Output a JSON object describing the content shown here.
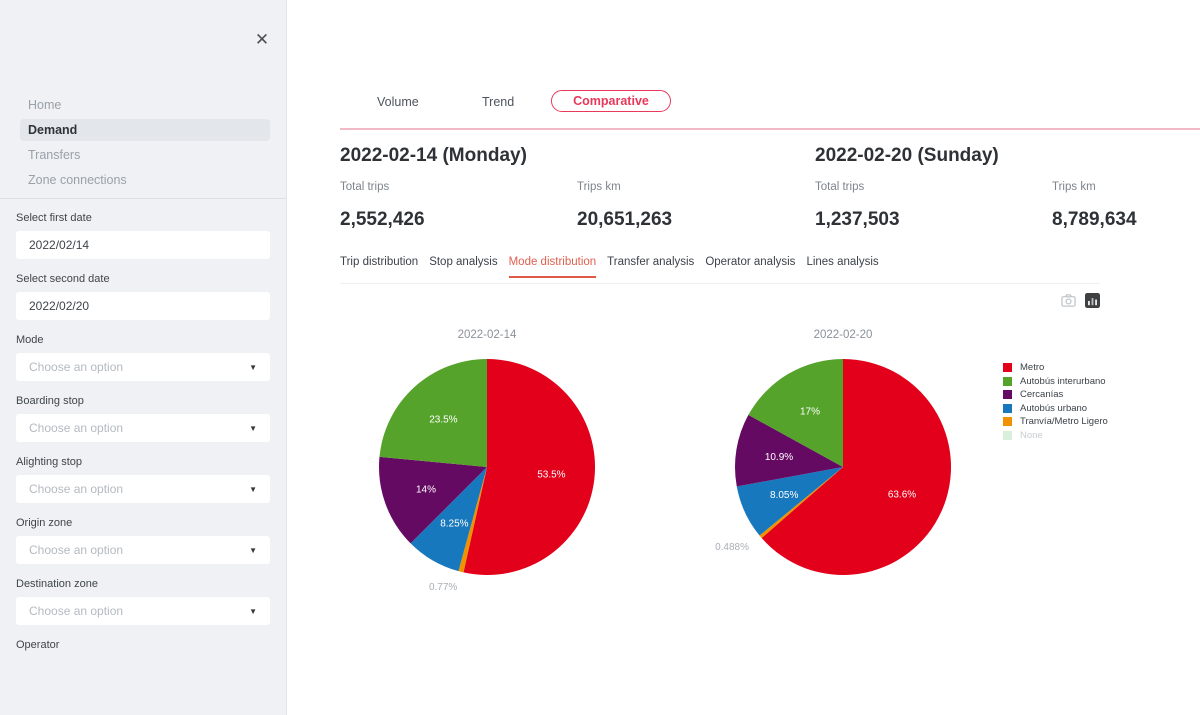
{
  "sidebar": {
    "close_icon": "✕",
    "nav": [
      {
        "label": "Home",
        "active": false
      },
      {
        "label": "Demand",
        "active": true
      },
      {
        "label": "Transfers",
        "active": false
      },
      {
        "label": "Zone connections",
        "active": false
      }
    ],
    "fields": [
      {
        "label": "Select first date",
        "type": "input",
        "value": "2022/02/14"
      },
      {
        "label": "Select second date",
        "type": "input",
        "value": "2022/02/20"
      },
      {
        "label": "Mode",
        "type": "select",
        "placeholder": "Choose an option"
      },
      {
        "label": "Boarding stop",
        "type": "select",
        "placeholder": "Choose an option"
      },
      {
        "label": "Alighting stop",
        "type": "select",
        "placeholder": "Choose an option"
      },
      {
        "label": "Origin zone",
        "type": "select",
        "placeholder": "Choose an option"
      },
      {
        "label": "Destination zone",
        "type": "select",
        "placeholder": "Choose an option"
      },
      {
        "label": "Operator",
        "type": "label-only"
      }
    ]
  },
  "main": {
    "tabs": [
      {
        "label": "Volume",
        "active": false
      },
      {
        "label": "Trend",
        "active": false
      },
      {
        "label": "Comparative",
        "active": true
      }
    ],
    "panels": [
      {
        "title": "2022-02-14 (Monday)",
        "stats": [
          {
            "label": "Total trips",
            "value": "2,552,426"
          },
          {
            "label": "Trips km",
            "value": "20,651,263"
          }
        ]
      },
      {
        "title": "2022-02-20 (Sunday)",
        "stats": [
          {
            "label": "Total trips",
            "value": "1,237,503"
          },
          {
            "label": "Trips km",
            "value": "8,789,634"
          }
        ]
      }
    ],
    "subtabs": [
      {
        "label": "Trip distribution",
        "active": false
      },
      {
        "label": "Stop analysis",
        "active": false
      },
      {
        "label": "Mode distribution",
        "active": true
      },
      {
        "label": "Transfer analysis",
        "active": false
      },
      {
        "label": "Operator analysis",
        "active": false
      },
      {
        "label": "Lines analysis",
        "active": false
      }
    ]
  },
  "chart_data": [
    {
      "type": "pie",
      "title": "2022-02-14",
      "direction": "clockwise",
      "start_angle": "top",
      "labels": [
        "Metro",
        "Tranvía/Metro Ligero",
        "Autobús urbano",
        "Cercanías",
        "Autobús interurbano"
      ],
      "values": [
        53.5,
        0.77,
        8.25,
        14,
        23.5
      ],
      "display_labels": [
        "53.5%",
        "0.77%",
        "8.25%",
        "14%",
        "23.5%"
      ],
      "colors": [
        "#e2001a",
        "#f09200",
        "#1878bd",
        "#650a63",
        "#56a32b"
      ]
    },
    {
      "type": "pie",
      "title": "2022-02-20",
      "direction": "clockwise",
      "start_angle": "top",
      "labels": [
        "Metro",
        "Tranvía/Metro Ligero",
        "Autobús urbano",
        "Cercanías",
        "Autobús interurbano"
      ],
      "values": [
        63.6,
        0.488,
        8.05,
        10.9,
        17
      ],
      "display_labels": [
        "63.6%",
        "0.488%",
        "8.05%",
        "10.9%",
        "17%"
      ],
      "colors": [
        "#e2001a",
        "#f09200",
        "#1878bd",
        "#650a63",
        "#56a32b"
      ]
    }
  ],
  "legend": {
    "position": "right",
    "items": [
      {
        "label": "Metro",
        "color": "#e2001a",
        "muted": false
      },
      {
        "label": "Autobús interurbano",
        "color": "#56a32b",
        "muted": false
      },
      {
        "label": "Cercanías",
        "color": "#650a63",
        "muted": false
      },
      {
        "label": "Autobús urbano",
        "color": "#1878bd",
        "muted": false
      },
      {
        "label": "Tranvía/Metro Ligero",
        "color": "#f09200",
        "muted": false
      },
      {
        "label": "None",
        "color": "#d8efdc",
        "muted": true
      }
    ]
  },
  "colors": {
    "accent_red": "#e8395a",
    "active_subtab": "#df5848",
    "sidebar_bg": "#eff1f4",
    "nav_active_bg": "#e3e7eb",
    "pie_outside_label": "#a9afb5"
  }
}
